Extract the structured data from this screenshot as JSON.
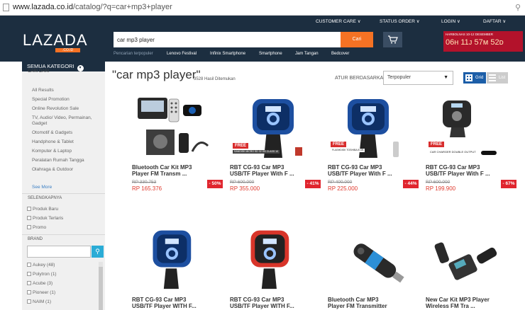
{
  "browser": {
    "url_host": "www.lazada.co.id",
    "url_path": "/catalog/?q=car+mp3+player"
  },
  "header": {
    "top_links": [
      "CUSTOMER CARE ∨",
      "STATUS ORDER ∨",
      "LOGIN ∨",
      "DAFTAR ∨"
    ],
    "logo": "LAZADA",
    "logo_sub": ".CO.ID",
    "search_value": "car mp3 player",
    "search_button": "Cari",
    "promo_line1": "HARBOLNAS 10-12 DESEMBER",
    "promo_line2": "06ʜ 11ᴊ 57ᴍ 52ᴅ",
    "quick_links_label": "Pencarian terpopuler",
    "quick_links": [
      "Lenovo Festival",
      "Infinix Smartphone",
      "Smartphone",
      "Jam Tangan",
      "Bedcover"
    ]
  },
  "sidebar": {
    "category_button": "SEMUA KATEGORI",
    "cari_dari": "CARI DARI",
    "categories": [
      "All Results",
      "Special Promotion",
      "Online Revolution Sale",
      "TV, Audio/ Video, Permainan,",
      "Gadget",
      "Otomotif & Gadgets",
      "Handphone & Tablet",
      "Komputer & Laptop",
      "Peralatan Rumah Tangga",
      "Olahraga & Outdoor"
    ],
    "see_more": "See More",
    "refine_title": "SELENGKAPNYA",
    "refine": [
      "Produk Baru",
      "Produk Terlaris",
      "Promo"
    ],
    "brand_title": "BRAND",
    "brands": [
      "Aukey (48)",
      "Polytron (1)",
      "Acube (3)",
      "Pioneer (1)",
      "NAIM (1)"
    ]
  },
  "main": {
    "query_title": "\"car mp3 player\"",
    "results_count": "3528 Hasil Ditemukan",
    "sort_label": "ATUR BERDASARKAN:",
    "sort_value": "Terpopuler",
    "grid_label": "Grid",
    "list_label": "List"
  },
  "products": [
    {
      "line1": "Bluetooth Car Kit MP3",
      "line2": "Player FM Transm ...",
      "old_price": "RP 330.753",
      "price": "RP 165.376",
      "discount": "- 50%",
      "free": ""
    },
    {
      "line1": "RBT CG-93 Car MP3",
      "line2": "USB/TF Player With F ...",
      "old_price": "RP 600.000",
      "price": "RP 355.000",
      "discount": "- 41%",
      "free": "FREE",
      "free_note": "SANDISK MICRO SD 32 GB CLASS 10"
    },
    {
      "line1": "RBT CG-93 Car MP3",
      "line2": "USB/TF Player With F ...",
      "old_price": "RP 400.000",
      "price": "RP 225.000",
      "discount": "- 44%",
      "free": "FREE",
      "free_note": "FLASHDISK TOSHIBA 8 GB"
    },
    {
      "line1": "RBT CG-93 Car MP3",
      "line2": "USB/TF Player With F ...",
      "old_price": "RP 600.000",
      "price": "RP 199.900",
      "discount": "- 67%",
      "free": "FREE",
      "free_note": "CAR CHARGER DOUBLE OUTPUT"
    },
    {
      "line1": "RBT CG-93 Car MP3",
      "line2": "USB/TF Player WITH F..."
    },
    {
      "line1": "RBT CG-93 Car MP3",
      "line2": "USB/TF Player WITH F..."
    },
    {
      "line1": "Bluetooth Car MP3",
      "line2": "Player FM Transmitter"
    },
    {
      "line1": "New Car Kit MP3 Player",
      "line2": "Wireless FM Tra ..."
    }
  ],
  "colors": {
    "header_bg": "#1c2e40",
    "accent": "#f57224",
    "discount": "#e0252e",
    "price": "#e03a2e"
  }
}
